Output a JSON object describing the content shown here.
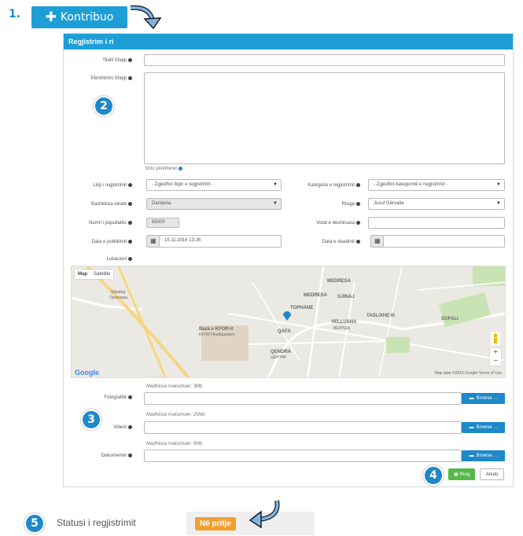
{
  "step_labels": {
    "one": "1.",
    "two": "2",
    "three": "3",
    "four": "4",
    "five": "5"
  },
  "kontribuo_button": {
    "label": "Kontribuo"
  },
  "panel": {
    "title": "Regjistrim i ri"
  },
  "form": {
    "title_label": "Titulli Shqip",
    "title_value": "",
    "description_label": "Përshkrimi Shqip",
    "description_value": "",
    "translate_note": "Shto përkthimin",
    "type_label": "Lloji i regjistrimit",
    "type_value": "- Zgjedhni llojin e regjistrimit -",
    "category_label": "Kategoria e regjistrimit",
    "category_value": "- Zgjedhni kategorinë e regjistrimit -",
    "municipality_label": "Bashkësia lokale",
    "municipality_value": "Dardania",
    "street_label": "Rruga",
    "street_value": "Jusuf Gërvalla",
    "population_label": "Numri i popullatës",
    "population_value": "65000",
    "voters_label": "Votat e deshiruara",
    "voters_value": "",
    "publish_date_label": "Data e publikimit",
    "publish_date_value": "15.11.2016 13:26",
    "expiry_date_label": "Data e skadimit",
    "expiry_date_value": "",
    "location_label": "Lokacioni",
    "photos_note": "Madhësia maksimale: 3Mb",
    "photos_label": "Fotografitë",
    "videos_note": "Madhësia maksimale: 25Mb",
    "videos_label": "Videot",
    "documents_note": "Madhësia maksimale: 5Mb",
    "documents_label": "Dokumentet",
    "browse_label": "Browse ...",
    "save_label": "Ruaj",
    "cancel_label": "Anulo"
  },
  "map": {
    "tab_map": "Map",
    "tab_satellite": "Satellite",
    "labels": {
      "shkabaj": "Shkabaj",
      "shkabaj_cyr": "Орановац",
      "medresa_top": "MEDRESA",
      "medresa": "MEDRESA",
      "gjinaj": "GJINAJ",
      "tophane": "TOPHANE",
      "taslixhe": "TASLIXHE III",
      "sofali": "SOFALI",
      "vellusha": "VELLUSHA",
      "velusha": "ВЕЛУША",
      "qafa": "QAFA",
      "kfor": "Baza e KFOR-it",
      "kfor_hq": "KFOR Headquarters",
      "qendra": "QENDRA",
      "centar": "ЦЕНТАР",
      "attribution": "Map data ©2016 Google   Terms of Use",
      "google": "Google"
    }
  },
  "status": {
    "label": "Statusi i regjistrimit",
    "value": "Në pritje"
  }
}
